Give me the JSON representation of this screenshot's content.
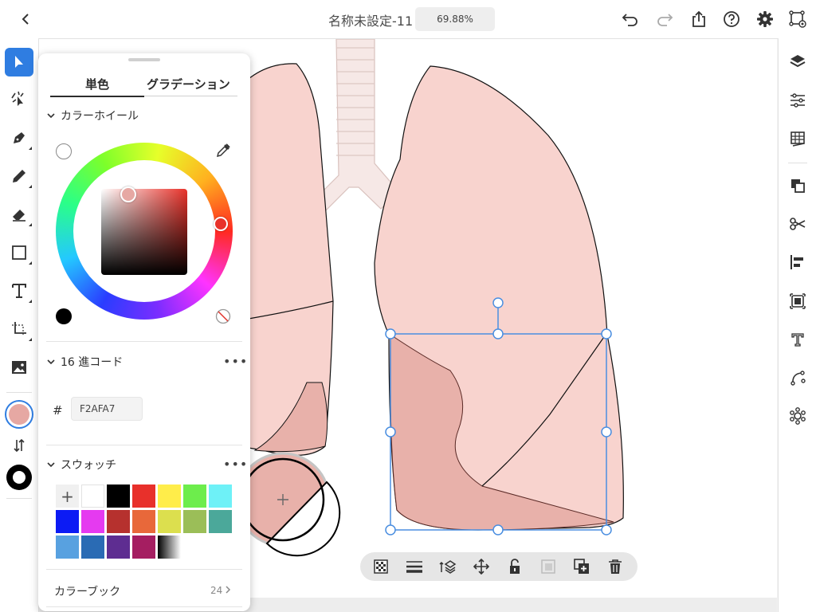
{
  "header": {
    "document_title": "名称未設定-11",
    "zoom_level": "69.88%",
    "icons": [
      "back-chevron-icon",
      "undo-icon",
      "redo-icon",
      "share-icon",
      "help-icon",
      "settings-icon",
      "livestream-icon"
    ]
  },
  "left_toolbar": {
    "tools": [
      "selection-tool",
      "direct-selection-tool",
      "pen-tool",
      "pencil-tool",
      "eraser-tool",
      "shape-tool",
      "type-tool",
      "transform-tool",
      "place-image-tool"
    ],
    "fill_color": "#e6a8a3",
    "stroke_color": "#000000"
  },
  "right_toolbar": {
    "icons": [
      "layers-icon",
      "properties-icon",
      "libraries-icon",
      "path-combine-icon",
      "cut-icon",
      "align-icon",
      "crop-icon",
      "text-icon",
      "path-icon",
      "repeat-icon"
    ]
  },
  "color_panel": {
    "tab_solid": "単色",
    "tab_gradient": "グラデーション",
    "color_wheel_title": "カラーホイール",
    "hex_title": "16 進コード",
    "hex_hash": "#",
    "hex_value": "F2AFA7",
    "swatches_title": "スウォッチ",
    "more": "•••",
    "color_book_label": "カラーブック",
    "color_book_count": "24",
    "swatch_colors": [
      "#ffffff",
      "#000000",
      "#e8302b",
      "#ffed4a",
      "#6ded4c",
      "#6ef1f7",
      "#0c1bf4",
      "#e53af0",
      "#b6312e",
      "#e8683a",
      "#dcdf4e",
      "#9bbe58",
      "#4ba89a",
      "#58a1e0",
      "#2a6bb4",
      "#5e2d91",
      "#a51e61",
      "gradient"
    ],
    "accent_color": "#2f7de1"
  },
  "selection_toolbar": {
    "icons": [
      "transparency-icon",
      "stroke-icon",
      "arrange-icon",
      "move-icon",
      "lock-icon",
      "mask-icon",
      "duplicate-icon",
      "delete-icon"
    ]
  },
  "artwork": {
    "lung_fill": "#f8d3ce",
    "lobe_fill": "#e8b1aa",
    "selection_color": "#4a8ee0"
  }
}
